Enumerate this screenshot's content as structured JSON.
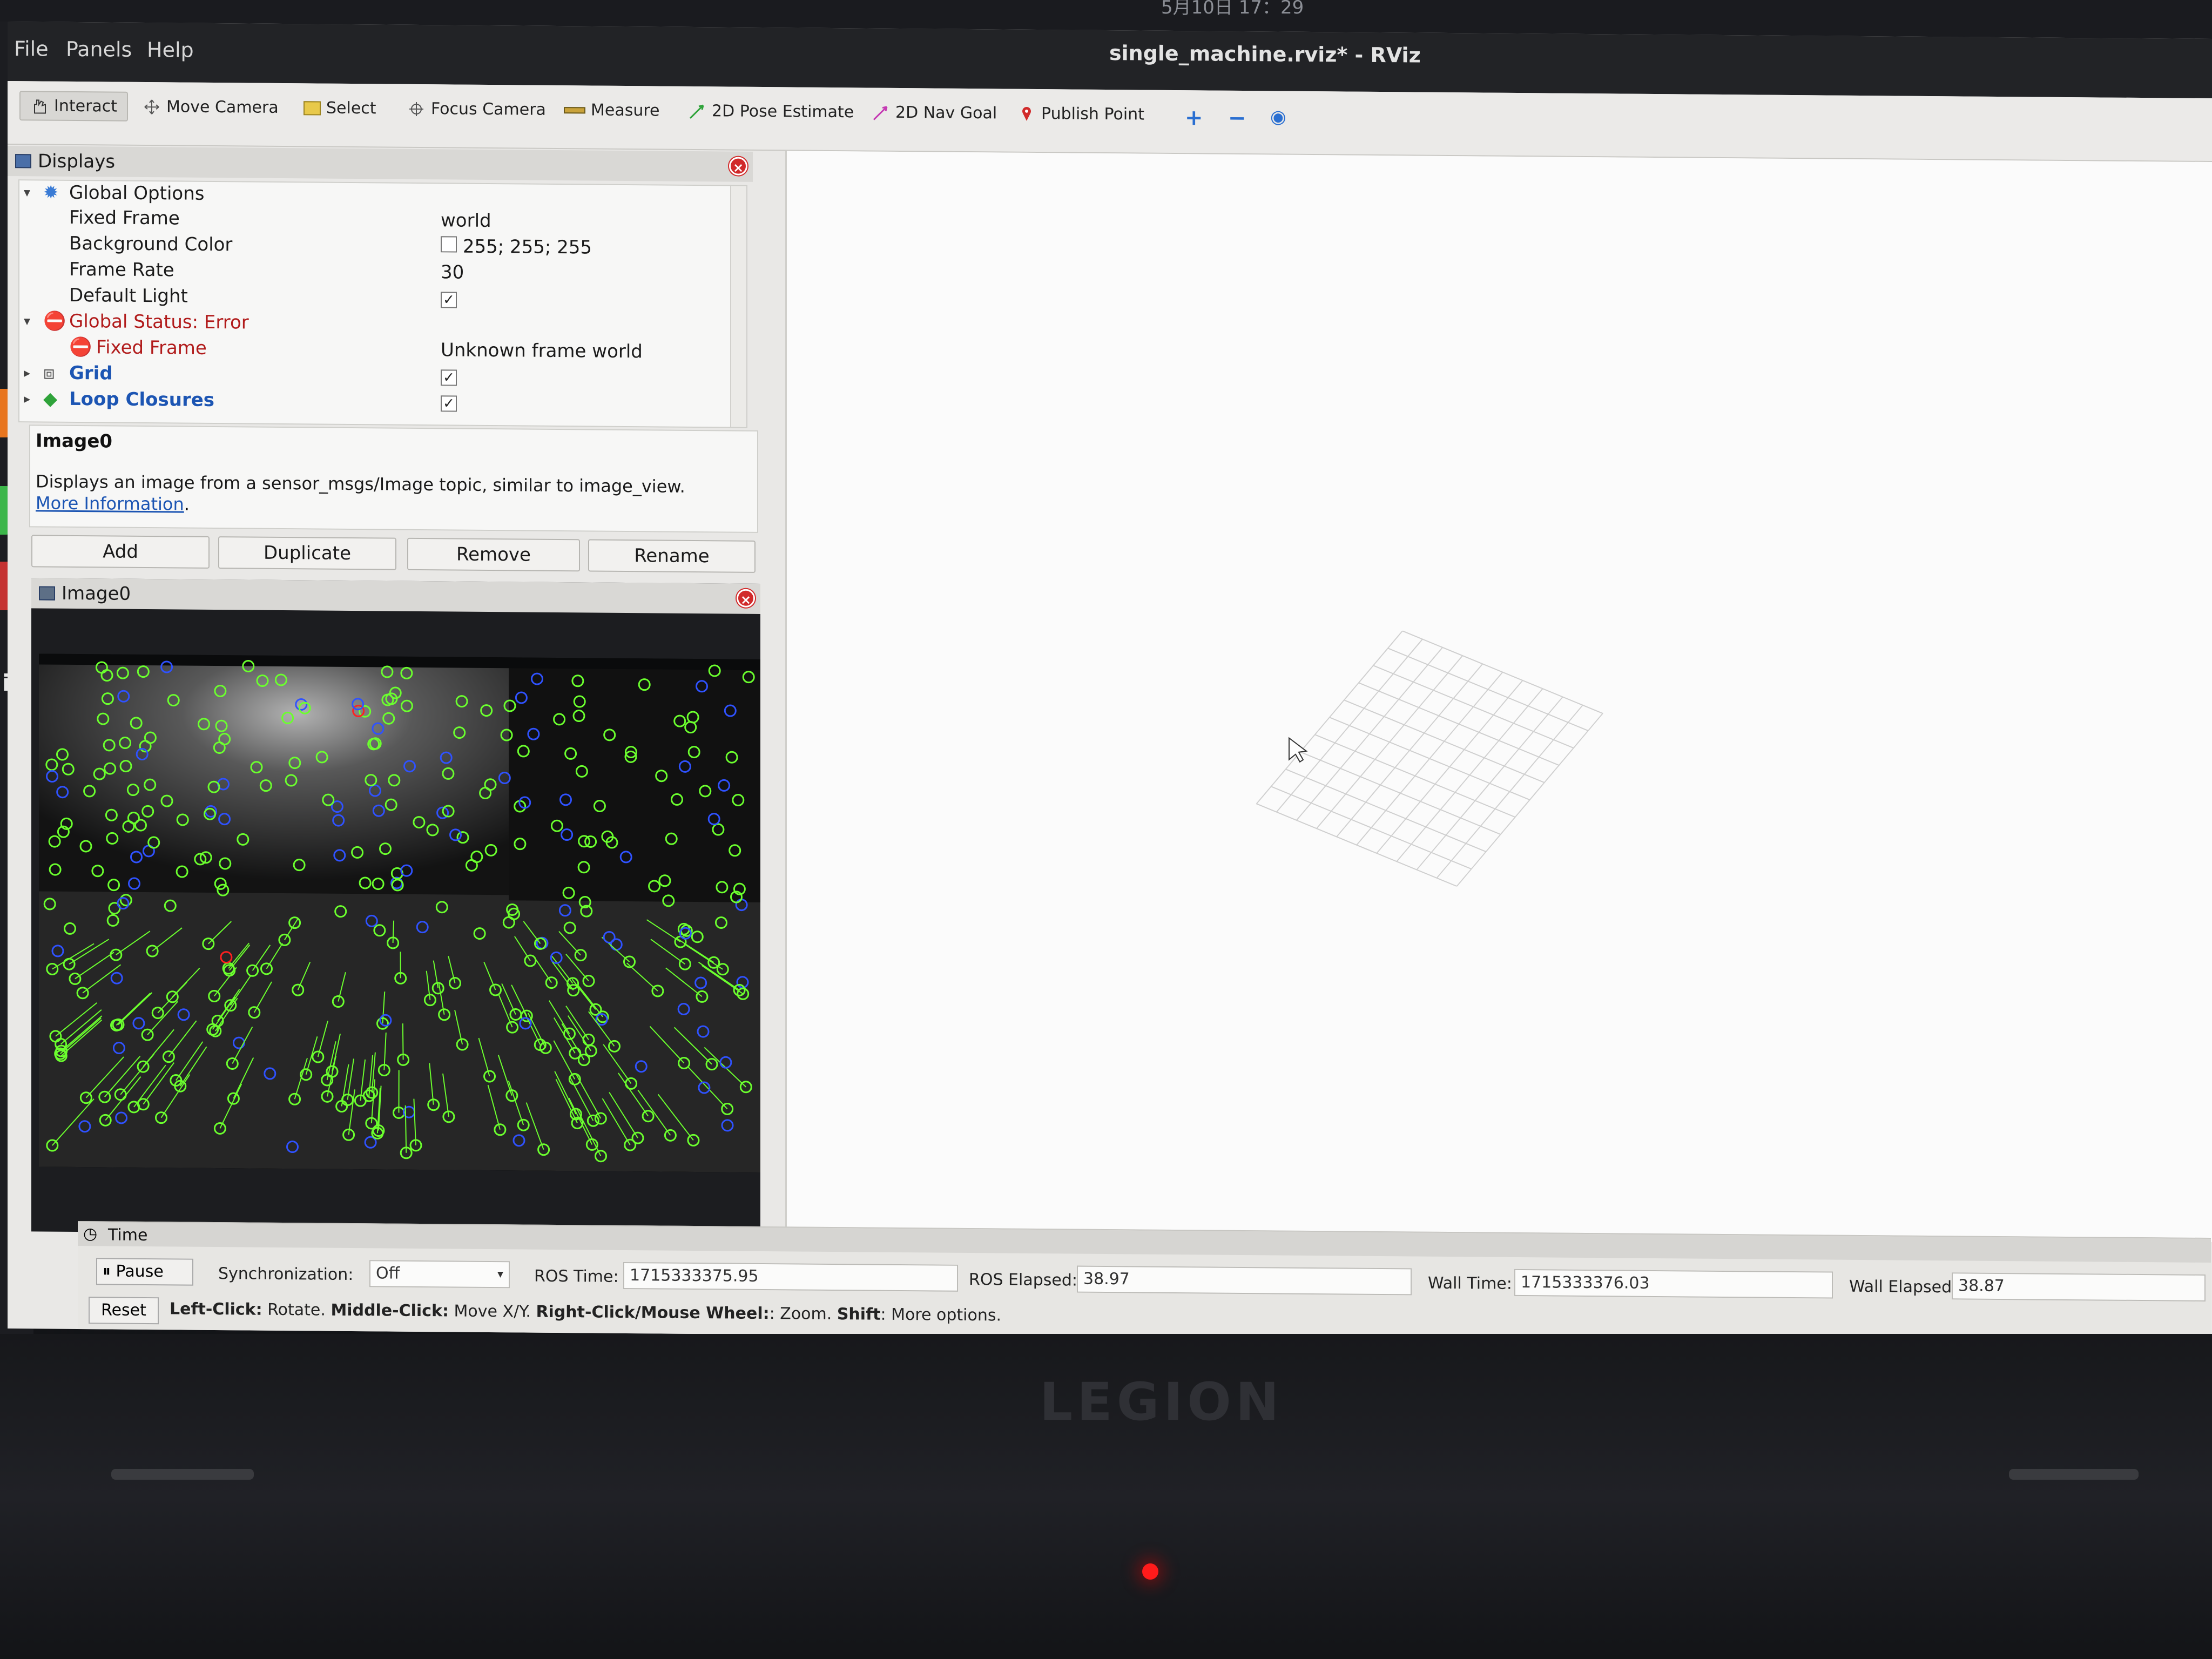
{
  "system": {
    "clock": "5月10日 17：29"
  },
  "window": {
    "title": "single_machine.rviz* - RViz",
    "menu": [
      "File",
      "Panels",
      "Help"
    ]
  },
  "toolbar": {
    "interact": "Interact",
    "move_camera": "Move Camera",
    "select": "Select",
    "focus_camera": "Focus Camera",
    "measure": "Measure",
    "pose_estimate": "2D Pose Estimate",
    "nav_goal": "2D Nav Goal",
    "publish_point": "Publish Point"
  },
  "displays": {
    "title": "Displays",
    "global_options": "Global Options",
    "fixed_frame_label": "Fixed Frame",
    "fixed_frame_value": "world",
    "bg_color_label": "Background Color",
    "bg_color_value": "255; 255; 255",
    "frame_rate_label": "Frame Rate",
    "frame_rate_value": "30",
    "default_light_label": "Default Light",
    "global_status": "Global Status: Error",
    "fixed_frame_error_label": "Fixed Frame",
    "fixed_frame_error_value": "Unknown frame world",
    "grid_label": "Grid",
    "loop_closures_label": "Loop Closures"
  },
  "description": {
    "title": "Image0",
    "text": "Displays an image from a sensor_msgs/Image topic, similar to image_view.",
    "link": "More Information",
    "link_suffix": "."
  },
  "buttons": {
    "add": "Add",
    "duplicate": "Duplicate",
    "remove": "Remove",
    "rename": "Rename"
  },
  "image_panel": {
    "title": "Image0"
  },
  "time_panel": {
    "title": "Time",
    "pause": "Pause",
    "sync_label": "Synchronization:",
    "sync_value": "Off",
    "ros_time_label": "ROS Time:",
    "ros_time_value": "1715333375.95",
    "ros_elapsed_label": "ROS Elapsed:",
    "ros_elapsed_value": "38.97",
    "wall_time_label": "Wall Time:",
    "wall_time_value": "1715333376.03",
    "wall_elapsed_label": "Wall Elapsed:",
    "wall_elapsed_value": "38.87"
  },
  "status_bar": {
    "reset": "Reset",
    "hint1_b": "Left-Click:",
    "hint1": " Rotate. ",
    "hint2_b": "Middle-Click:",
    "hint2": " Move X/Y. ",
    "hint3_b": "Right-Click/Mouse Wheel:",
    "hint3": ": Zoom. ",
    "hint4_b": "Shift",
    "hint4": ": More options."
  },
  "laptop": {
    "brand": "LEGION"
  },
  "colors": {
    "feature_green": "#6bff2e",
    "feature_blue": "#2f52ff",
    "feature_red": "#ff2020",
    "error_red": "#b11b1b",
    "link_blue": "#1c55b3"
  }
}
